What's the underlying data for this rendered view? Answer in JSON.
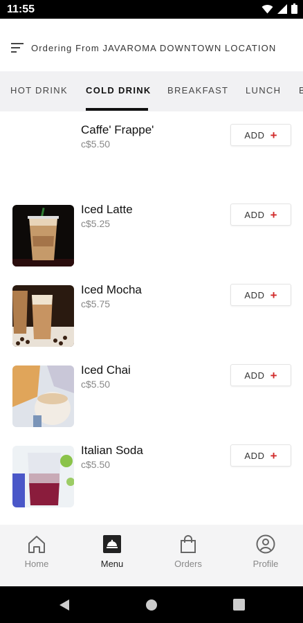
{
  "status_bar": {
    "time": "11:55"
  },
  "header": {
    "title": "Ordering From JAVAROMA DOWNTOWN LOCATION"
  },
  "tabs": [
    {
      "label": "HOT DRINK",
      "active": false
    },
    {
      "label": "COLD DRINK",
      "active": true
    },
    {
      "label": "BREAKFAST",
      "active": false
    },
    {
      "label": "LUNCH",
      "active": false
    },
    {
      "label": "B",
      "active": false
    }
  ],
  "add_label": "ADD",
  "items": [
    {
      "name": "Caffe' Frappe'",
      "price": "c$5.50",
      "has_image": false
    },
    {
      "name": "Iced Latte",
      "price": "c$5.25",
      "has_image": true
    },
    {
      "name": "Iced Mocha",
      "price": "c$5.75",
      "has_image": true
    },
    {
      "name": "Iced Chai",
      "price": "c$5.50",
      "has_image": true
    },
    {
      "name": "Italian Soda",
      "price": "c$5.50",
      "has_image": true
    }
  ],
  "bottom_nav": [
    {
      "label": "Home",
      "icon": "home-icon",
      "active": false
    },
    {
      "label": "Menu",
      "icon": "menu-icon",
      "active": true
    },
    {
      "label": "Orders",
      "icon": "shopping-bag-icon",
      "active": false
    },
    {
      "label": "Profile",
      "icon": "profile-icon",
      "active": false
    }
  ],
  "colors": {
    "accent": "#d12b2b",
    "tab_bg": "#f1f1f3",
    "nav_bg": "#f4f4f5"
  }
}
